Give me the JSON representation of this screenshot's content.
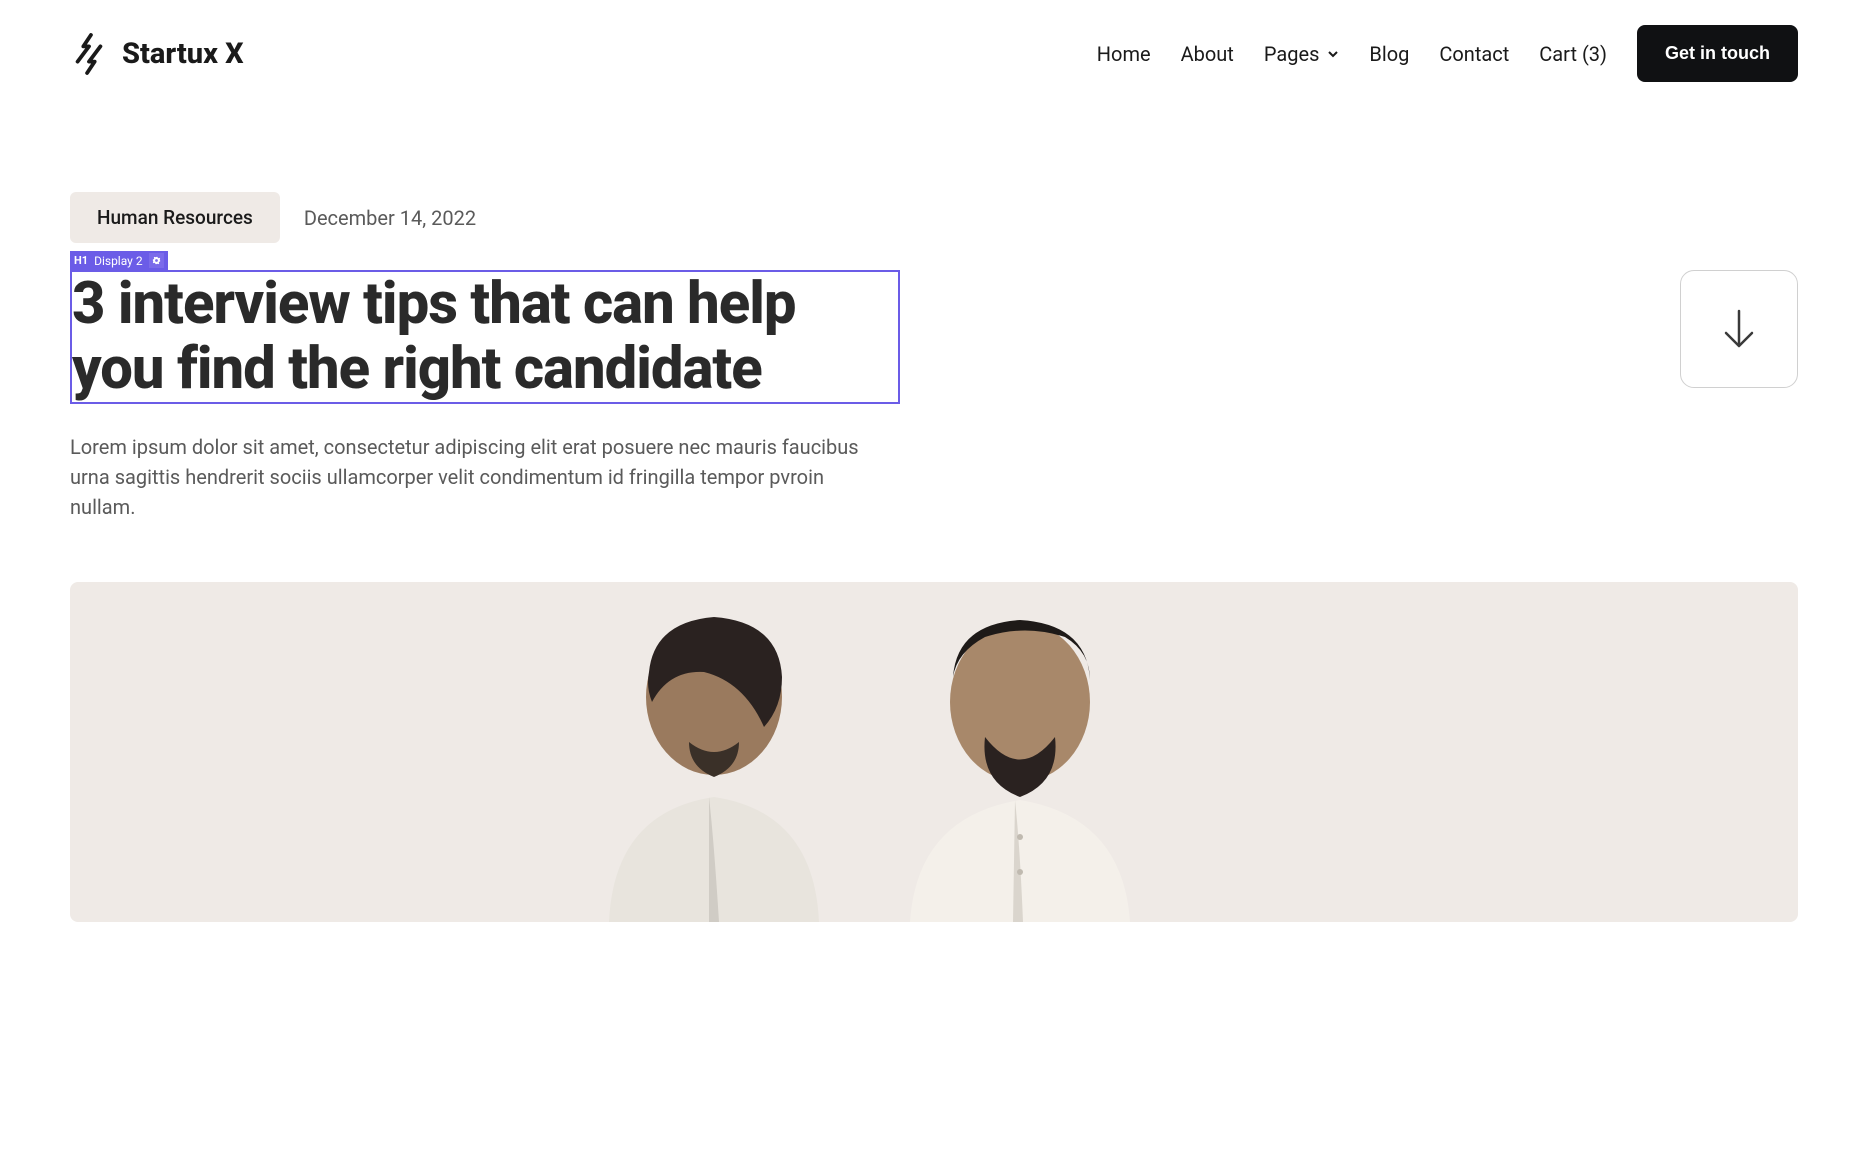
{
  "brand": {
    "name": "Startux X"
  },
  "nav": {
    "home": "Home",
    "about": "About",
    "pages": "Pages",
    "blog": "Blog",
    "contact": "Contact",
    "cart": "Cart (3)",
    "cta": "Get in touch"
  },
  "post": {
    "category": "Human Resources",
    "date": "December 14, 2022",
    "title": "3 interview tips that can help you find the right candidate",
    "excerpt": "Lorem ipsum dolor sit amet, consectetur adipiscing elit erat posuere nec mauris faucibus urna sagittis hendrerit sociis ullamcorper velit condimentum id fringilla tempor pvroin nullam."
  },
  "editor": {
    "elementTag": "H1",
    "elementClass": "Display 2"
  }
}
